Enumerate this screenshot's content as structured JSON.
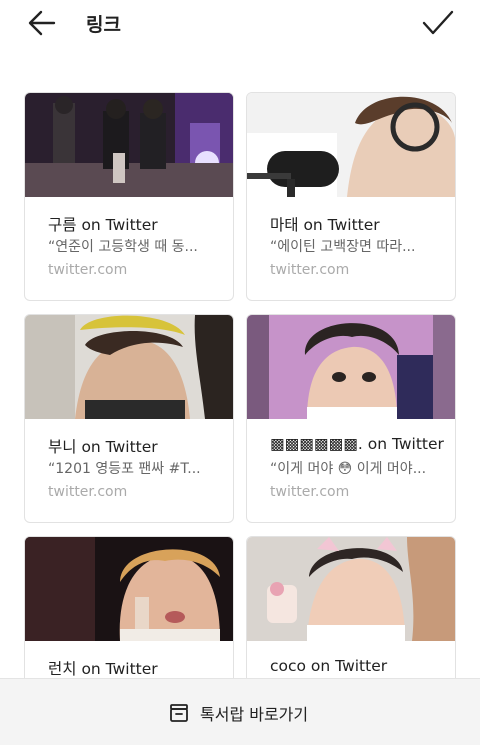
{
  "header": {
    "title": "링크"
  },
  "cards": [
    {
      "title": "구름 on Twitter",
      "desc": "“연준이 고등학생 때 동...",
      "domain": "twitter.com"
    },
    {
      "title": "마태 on Twitter",
      "desc": "“에이틴 고백장면 따라...",
      "domain": "twitter.com"
    },
    {
      "title": "부니 on Twitter",
      "desc": "“1201 영등포 팬싸 #T...",
      "domain": "twitter.com"
    },
    {
      "title": "▩▩▩▩▩▩. on Twitter",
      "desc": "“이게 머야 😳 이게 머야...",
      "domain": "twitter.com"
    },
    {
      "title": "런치 on Twitter",
      "desc": "",
      "domain": ""
    },
    {
      "title": "coco on Twitter",
      "desc": "",
      "domain": ""
    }
  ],
  "bottom": {
    "drawer_label": "톡서랍 바로가기"
  }
}
